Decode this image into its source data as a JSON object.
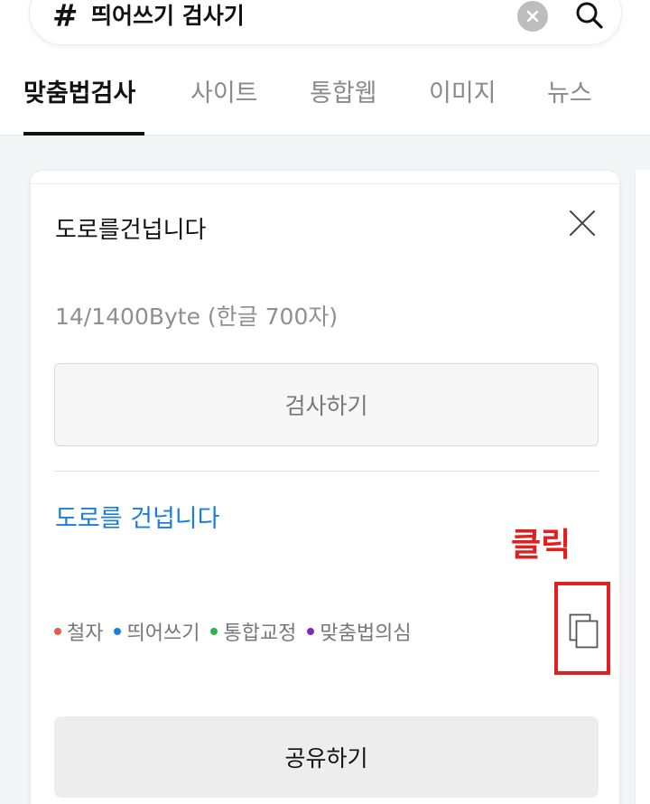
{
  "search": {
    "hash": "#",
    "query": "띄어쓰기 검사기"
  },
  "tabs": [
    {
      "label": "맞춤법검사",
      "active": true
    },
    {
      "label": "사이트"
    },
    {
      "label": "통합웹"
    },
    {
      "label": "이미지"
    },
    {
      "label": "뉴스"
    }
  ],
  "card": {
    "input_text": "도로를건넙니다",
    "byte_count": "14/1400Byte (한글 700자)",
    "check_button": "검사하기",
    "result_text": "도로를 건넙니다",
    "legend": [
      {
        "label": "철자",
        "color": "#e85a4f"
      },
      {
        "label": "띄어쓰기",
        "color": "#1c7ed6"
      },
      {
        "label": "통합교정",
        "color": "#2fb344"
      },
      {
        "label": "맞춤법의심",
        "color": "#7b2cbf"
      }
    ],
    "share_button": "공유하기"
  },
  "annotation": {
    "text": "클릭",
    "color": "#e02020"
  },
  "icons": {
    "clear": "clear-icon",
    "search": "search-icon",
    "close": "close-icon",
    "copy": "copy-icon"
  }
}
